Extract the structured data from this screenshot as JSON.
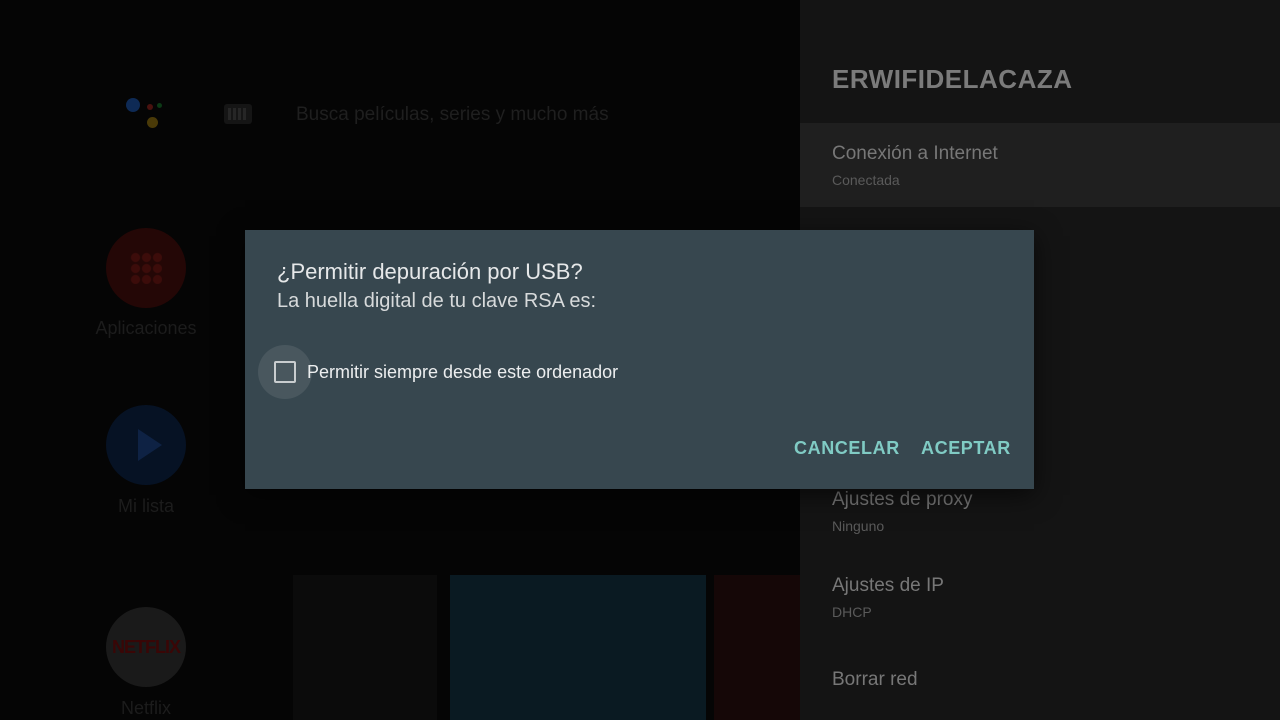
{
  "home": {
    "search_hint": "Busca películas, series y mucho más",
    "tiles": [
      {
        "label": "Aplicaciones",
        "icon": "apps-grid-icon"
      },
      {
        "label": "Mi lista",
        "icon": "play-icon"
      },
      {
        "label": "Netflix",
        "icon": "netflix-logo",
        "logo_text": "NETFLIX"
      }
    ],
    "assistant_icon": "google-assistant-icon",
    "keyboard_icon": "keyboard-icon"
  },
  "panel": {
    "title": "ERWIFIDELACAZA",
    "items": [
      {
        "label": "Conexión a Internet",
        "sub": "Conectada",
        "focused": true
      },
      {
        "label": "Ajustes de proxy",
        "sub": "Ninguno"
      },
      {
        "label": "Ajustes de IP",
        "sub": "DHCP"
      },
      {
        "label": "Borrar red"
      }
    ]
  },
  "dialog": {
    "title": "¿Permitir depuración por USB?",
    "message": "La huella digital de tu clave RSA es:",
    "checkbox_label": "Permitir siempre desde este ordenador",
    "checkbox_checked": false,
    "cancel_label": "CANCELAR",
    "accept_label": "ACEPTAR",
    "accent_color": "#80cbc4",
    "background_color": "#37474f"
  }
}
